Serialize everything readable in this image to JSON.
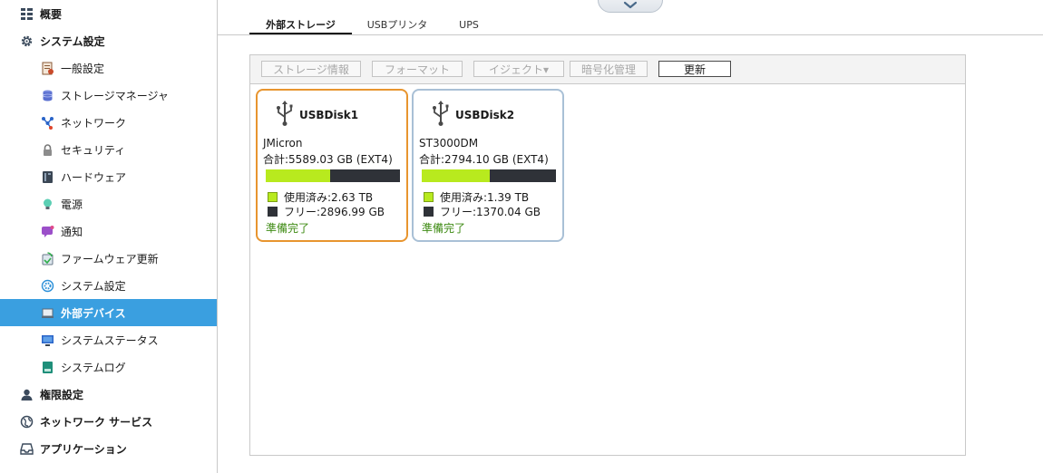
{
  "sidebar": {
    "items": [
      {
        "label": "概要",
        "icon": "overview-grid-icon",
        "level": "top"
      },
      {
        "label": "システム設定",
        "icon": "gear-icon",
        "level": "top"
      },
      {
        "label": "一般設定",
        "icon": "general-settings-icon",
        "level": "sub"
      },
      {
        "label": "ストレージマネージャ",
        "icon": "storage-stack-icon",
        "level": "sub"
      },
      {
        "label": "ネットワーク",
        "icon": "network-nodes-icon",
        "level": "sub"
      },
      {
        "label": "セキュリティ",
        "icon": "lock-icon",
        "level": "sub"
      },
      {
        "label": "ハードウェア",
        "icon": "hardware-icon",
        "level": "sub"
      },
      {
        "label": "電源",
        "icon": "power-bulb-icon",
        "level": "sub"
      },
      {
        "label": "通知",
        "icon": "notification-icon",
        "level": "sub"
      },
      {
        "label": "ファームウェア更新",
        "icon": "firmware-update-icon",
        "level": "sub"
      },
      {
        "label": "システム設定",
        "icon": "system-settings-icon",
        "level": "sub"
      },
      {
        "label": "外部デバイス",
        "icon": "external-device-icon",
        "level": "sub",
        "active": true
      },
      {
        "label": "システムステータス",
        "icon": "monitor-icon",
        "level": "sub"
      },
      {
        "label": "システムログ",
        "icon": "log-icon",
        "level": "sub"
      },
      {
        "label": "権限設定",
        "icon": "user-icon",
        "level": "top"
      },
      {
        "label": "ネットワーク サービス",
        "icon": "globe-icon",
        "level": "top"
      },
      {
        "label": "アプリケーション",
        "icon": "inbox-tray-icon",
        "level": "top"
      }
    ]
  },
  "tabs": [
    {
      "label": "外部ストレージ",
      "active": true
    },
    {
      "label": "USBプリンタ",
      "active": false
    },
    {
      "label": "UPS",
      "active": false
    }
  ],
  "toolbar": {
    "storage_info": "ストレージ情報",
    "format": "フォーマット",
    "eject": "イジェクト▾",
    "encryption": "暗号化管理",
    "refresh": "更新"
  },
  "devices": [
    {
      "name": "USBDisk1",
      "model": "JMicron",
      "total": "合計:5589.03 GB (EXT4)",
      "used": "使用済み:2.63 TB",
      "free": "フリー:2896.99 GB",
      "used_fraction": 0.48,
      "status": "準備完了",
      "selected": true
    },
    {
      "name": "USBDisk2",
      "model": "ST3000DM",
      "total": "合計:2794.10 GB (EXT4)",
      "used": "使用済み:1.39 TB",
      "free": "フリー:1370.04 GB",
      "used_fraction": 0.51,
      "status": "準備完了",
      "selected": false
    }
  ],
  "colors": {
    "accent": "#3a9fe0",
    "selected_border": "#e8952f",
    "card_border": "#a9c0d6",
    "used": "#b8ea1e",
    "free": "#2f3238",
    "status": "#3d8a12"
  }
}
